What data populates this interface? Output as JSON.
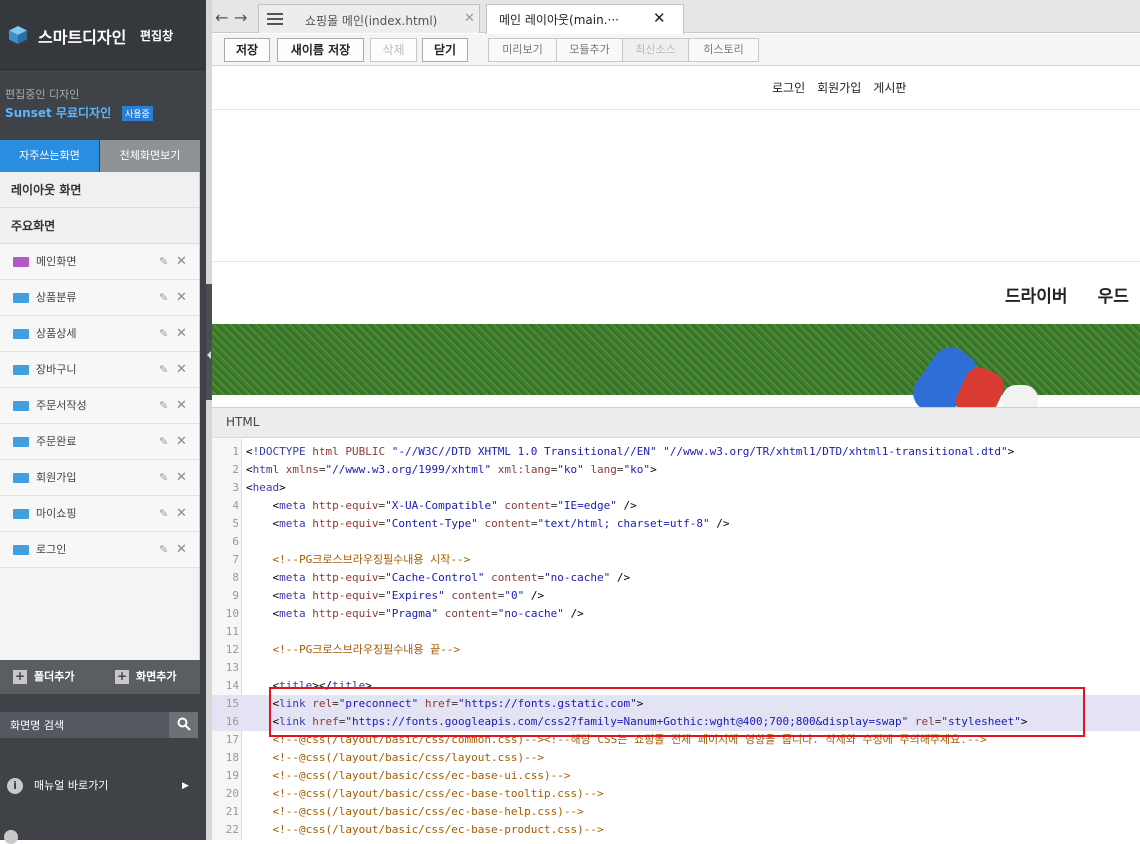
{
  "brand": {
    "name": "스마트디자인",
    "subtitle": "편집창"
  },
  "editing": {
    "label": "편집중인 디자인",
    "design_name": "Sunset 무료디자인",
    "badge": "사용중"
  },
  "sidebar_tabs": [
    {
      "label": "자주쓰는화면",
      "active": true
    },
    {
      "label": "전체화면보기",
      "active": false
    }
  ],
  "groups": {
    "layout_title": "레이아웃 화면",
    "main_title": "주요화면"
  },
  "screens": [
    {
      "label": "메인화면",
      "icon": "main-page-icon"
    },
    {
      "label": "상품분류",
      "icon": "html-page-icon"
    },
    {
      "label": "상품상세",
      "icon": "html-page-icon"
    },
    {
      "label": "장바구니",
      "icon": "html-page-icon"
    },
    {
      "label": "주문서작성",
      "icon": "html-page-icon"
    },
    {
      "label": "주문완료",
      "icon": "html-page-icon"
    },
    {
      "label": "회원가입",
      "icon": "html-page-icon"
    },
    {
      "label": "마이쇼핑",
      "icon": "html-page-icon"
    },
    {
      "label": "로그인",
      "icon": "html-page-icon"
    }
  ],
  "panel_footer": {
    "add_folder": "폴더추가",
    "add_screen": "화면추가"
  },
  "search": {
    "placeholder": "화면명 검색"
  },
  "manual": {
    "label": "매뉴얼 바로가기"
  },
  "file_tabs": [
    {
      "label": "쇼핑몰 메인(index.html)",
      "active": false
    },
    {
      "label": "메인 레이아웃(main.···",
      "active": true
    }
  ],
  "toolbar": {
    "save": "저장",
    "save_as": "새이름 저장",
    "delete": "삭제",
    "close": "닫기",
    "preview": "미리보기",
    "add_module": "모듈추가",
    "latest_source": "최신소스",
    "history": "히스토리"
  },
  "preview": {
    "top_links": [
      "로그인",
      "회원가입",
      "게시판"
    ],
    "categories": [
      "드라이버",
      "우드"
    ]
  },
  "html_panel": {
    "title": "HTML"
  },
  "code_lines": [
    {
      "n": "1",
      "text": "<!DOCTYPE html PUBLIC \"-//W3C//DTD XHTML 1.0 Transitional//EN\" \"//www.w3.org/TR/xhtml1/DTD/xhtml1-transitional.dtd\">"
    },
    {
      "n": "2",
      "text": "<html xmlns=\"//www.w3.org/1999/xhtml\" xml:lang=\"ko\" lang=\"ko\">"
    },
    {
      "n": "3",
      "text": "<head>"
    },
    {
      "n": "4",
      "text": "    <meta http-equiv=\"X-UA-Compatible\" content=\"IE=edge\" />"
    },
    {
      "n": "5",
      "text": "    <meta http-equiv=\"Content-Type\" content=\"text/html; charset=utf-8\" />"
    },
    {
      "n": "6",
      "text": ""
    },
    {
      "n": "7",
      "text": "    <!--PG크로스브라우징필수내용 시작-->"
    },
    {
      "n": "8",
      "text": "    <meta http-equiv=\"Cache-Control\" content=\"no-cache\" />"
    },
    {
      "n": "9",
      "text": "    <meta http-equiv=\"Expires\" content=\"0\" />"
    },
    {
      "n": "10",
      "text": "    <meta http-equiv=\"Pragma\" content=\"no-cache\" />"
    },
    {
      "n": "11",
      "text": ""
    },
    {
      "n": "12",
      "text": "    <!--PG크로스브라우징필수내용 끝-->"
    },
    {
      "n": "13",
      "text": ""
    },
    {
      "n": "14",
      "text": "    <title></title>"
    },
    {
      "n": "15",
      "text": "    <link rel=\"preconnect\" href=\"https://fonts.gstatic.com\">"
    },
    {
      "n": "16",
      "text": "    <link href=\"https://fonts.googleapis.com/css2?family=Nanum+Gothic:wght@400;700;800&display=swap\" rel=\"stylesheet\">"
    },
    {
      "n": "17",
      "text": "    <!--@css(/layout/basic/css/common.css)--><!--해당 CSS는 쇼핑몰 전체 페이지에 영향을 줍니다. 삭제와 수정에 주의해주세요.-->"
    },
    {
      "n": "18",
      "text": "    <!--@css(/layout/basic/css/layout.css)-->"
    },
    {
      "n": "19",
      "text": "    <!--@css(/layout/basic/css/ec-base-ui.css)-->"
    },
    {
      "n": "20",
      "text": "    <!--@css(/layout/basic/css/ec-base-tooltip.css)-->"
    },
    {
      "n": "21",
      "text": "    <!--@css(/layout/basic/css/ec-base-help.css)-->"
    },
    {
      "n": "22",
      "text": "    <!--@css(/layout/basic/css/ec-base-product.css)-->"
    }
  ],
  "highlighted_lines": [
    "15",
    "16"
  ],
  "colors": {
    "accent": "#2b8ddf",
    "highlight_box": "#e0141e",
    "sidebar_bg": "#3f4247"
  }
}
